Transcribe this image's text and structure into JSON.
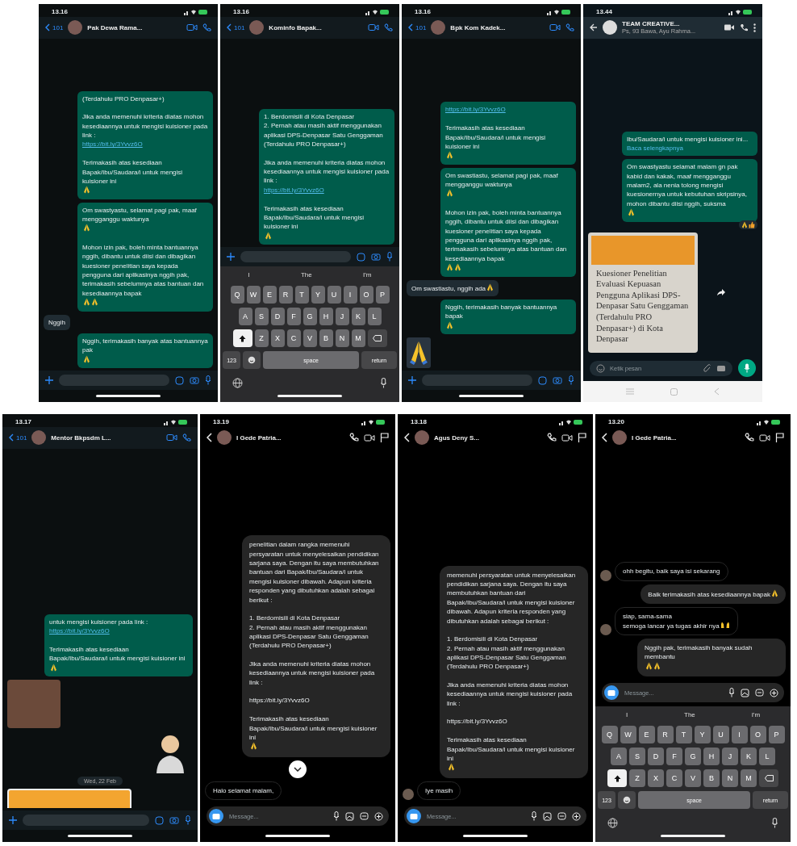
{
  "screens": [
    {
      "kind": "wa_ios",
      "time": "13.16",
      "back_count": "101",
      "name": "Pak Dewa Rama...",
      "messages": [
        {
          "kind": "out",
          "parts": [
            {
              "kind": "text",
              "text": "(Terdahulu PRO Denpasar+)\n\nJika anda memenuhi kriteria diatas mohon kesediaannya untuk mengisi kuisioner pada link :"
            },
            {
              "kind": "link",
              "text": "https://bit.ly/3Yvvz6O"
            },
            {
              "kind": "text",
              "text": "\nTerimakasih atas kesediaan Bapak/Ibu/Saudara/i untuk mengisi kuisioner ini"
            },
            {
              "kind": "pray"
            }
          ]
        },
        {
          "kind": "out",
          "parts": [
            {
              "kind": "text",
              "text": "Om swastyastu, selamat pagi pak, maaf mengganggu waktunya"
            },
            {
              "kind": "pray"
            },
            {
              "kind": "text",
              "text": "\nMohon izin pak, boleh minta bantuannya nggih, dibantu untuk diisi dan dibagikan kuesioner penelitian saya kepada pengguna dari aplikasinya nggih pak, terimakasih sebelumnya atas bantuan dan kesediaannya bapak"
            },
            {
              "kind": "pray"
            },
            {
              "kind": "pray"
            }
          ]
        },
        {
          "kind": "in",
          "parts": [
            {
              "kind": "text",
              "text": "Nggih"
            }
          ]
        },
        {
          "kind": "out",
          "parts": [
            {
              "kind": "text",
              "text": "Nggih, terimakasih banyak atas bantuannya pak"
            },
            {
              "kind": "pray"
            }
          ]
        }
      ]
    },
    {
      "kind": "wa_ios",
      "time": "13.16",
      "back_count": "101",
      "name": "Kominfo Bapak...",
      "messages": [
        {
          "kind": "out",
          "parts": [
            {
              "kind": "text",
              "text": "1. Berdomisili di Kota Denpasar\n2. Pernah atau masih aktif menggunakan aplikasi DPS-Denpasar Satu Genggaman (Terdahulu PRO Denpasar+)\n\nJika anda memenuhi kriteria diatas mohon kesediaannya untuk mengisi kuisioner pada link :"
            },
            {
              "kind": "link",
              "text": "https://bit.ly/3Yvvz6O"
            },
            {
              "kind": "text",
              "text": "\nTerimakasih atas kesediaan Bapak/Ibu/Saudara/i untuk mengisi kuisioner ini"
            },
            {
              "kind": "pray"
            }
          ]
        }
      ],
      "keyboard": {
        "suggestions": [
          "I",
          "The",
          "I'm"
        ],
        "rows": [
          [
            "Q",
            "W",
            "E",
            "R",
            "T",
            "Y",
            "U",
            "I",
            "O",
            "P"
          ],
          [
            "A",
            "S",
            "D",
            "F",
            "G",
            "H",
            "J",
            "K",
            "L"
          ],
          [
            "Z",
            "X",
            "C",
            "V",
            "B",
            "N",
            "M"
          ]
        ],
        "shift_on": true,
        "numbers": "123",
        "space": "space",
        "return": "return"
      }
    },
    {
      "kind": "wa_ios",
      "time": "13.16",
      "back_count": "101",
      "name": "Bpk Kom Kadek...",
      "messages": [
        {
          "kind": "out",
          "parts": [
            {
              "kind": "link",
              "text": "https://bit.ly/3Yvvz6O"
            },
            {
              "kind": "text",
              "text": "\nTerimakasih atas kesediaan Bapak/Ibu/Saudara/i untuk mengisi kuisioner ini"
            },
            {
              "kind": "pray"
            }
          ]
        },
        {
          "kind": "out",
          "parts": [
            {
              "kind": "text",
              "text": "Om swastiastu, selamat pagi pak, maaf mengganggu waktunya"
            },
            {
              "kind": "pray"
            },
            {
              "kind": "text",
              "text": "\nMohon izin pak, boleh minta bantuannya nggih, dibantu untuk diisi dan dibagikan kuesioner penelitian saya kepada pengguna dari aplikasinya nggih pak, terimakasih sebelumnya atas bantuan dan kesediaannya bapak"
            },
            {
              "kind": "pray"
            },
            {
              "kind": "pray"
            }
          ]
        },
        {
          "kind": "in",
          "parts": [
            {
              "kind": "text",
              "text": "Om swastiastu, nggih ada"
            },
            {
              "kind": "pray"
            }
          ]
        },
        {
          "kind": "out",
          "parts": [
            {
              "kind": "text",
              "text": "Nggih, terimakasih banyak bantuannya bapak"
            },
            {
              "kind": "pray"
            }
          ]
        },
        {
          "kind": "sticker_pray"
        }
      ]
    },
    {
      "kind": "wa_android",
      "time": "13.44",
      "name": "TEAM CREATIVE...",
      "subtitle": "Ps, 93 Bawa, Ayu Rahma...",
      "placeholder": "Ketik pesan",
      "messages": [
        {
          "kind": "out",
          "parts": [
            {
              "kind": "text",
              "text": "Ibu/Saudara/i untuk mengisi kuisioner ini..."
            },
            {
              "kind": "more",
              "text": "Baca selengkapnya"
            }
          ]
        },
        {
          "kind": "out",
          "parts": [
            {
              "kind": "text",
              "text": "Om swastyastu selamat malam gn pak kabid dan kakak, maaf mengganggu malam2, ala nenia tolong mengisi kuesionernya untuk kebutuhan skripsinya, mohon dibantu diisi nggih, suksma"
            },
            {
              "kind": "pray"
            }
          ],
          "reactions": [
            {
              "kind": "pray"
            },
            {
              "kind": "thumbs"
            }
          ]
        },
        {
          "kind": "shared_card",
          "title": "Kuesioner Penelitian Evaluasi Kepuasan Pengguna Aplikasi DPS-Denpasar Satu Genggaman (Terdahulu PRO Denpasar+) di Kota Denpasar"
        }
      ]
    },
    {
      "kind": "wa_ios",
      "time": "13.17",
      "back_count": "101",
      "name": "Mentor Bkpsdm L...",
      "messages": [
        {
          "kind": "out",
          "parts": [
            {
              "kind": "text",
              "text": "untuk mengisi kuisioner pada link :"
            },
            {
              "kind": "link",
              "text": "https://bit.ly/3Yvvz6O"
            },
            {
              "kind": "text",
              "text": "\nTerimakasih atas kesediaan Bapak/Ibu/Saudara/i untuk mengisi kuisioner ini"
            },
            {
              "kind": "pray"
            }
          ]
        },
        {
          "kind": "sticker_photo"
        },
        {
          "kind": "sticker_avatar"
        },
        {
          "kind": "date",
          "text": "Wed, 22 Feb"
        },
        {
          "kind": "card"
        }
      ]
    },
    {
      "kind": "instagram",
      "time": "13.19",
      "name": "I Gede Patria...",
      "placeholder": "Message...",
      "messages": [
        {
          "kind": "out",
          "parts": [
            {
              "kind": "text",
              "text": "penelitian dalam rangka memenuhi persyaratan untuk menyelesaikan pendidikan sarjana saya. Dengan itu saya membutuhkan bantuan dari Bapak/Ibu/Saudara/i untuk mengisi kuisioner dibawah. Adapun kriteria responden yang dibutuhkan adalah sebagai berikut :\n\n1. Berdomisili di Kota Denpasar\n2. Pernah atau masih aktif menggunakan aplikasi DPS-Denpasar Satu Genggaman (Terdahulu PRO Denpasar+)\n\nJika anda memenuhi kriteria diatas mohon kesediaannya untuk mengisi kuisioner pada link :\n\nhttps://bit.ly/3Yvvz6O\n\nTerimakasih atas kesediaan Bapak/Ibu/Saudara/i untuk mengisi kuisioner ini"
            },
            {
              "kind": "pray"
            }
          ]
        },
        {
          "kind": "scroll_button"
        },
        {
          "kind": "in",
          "parts": [
            {
              "kind": "text",
              "text": "Halo selamat malam,"
            }
          ]
        }
      ]
    },
    {
      "kind": "instagram",
      "time": "13.18",
      "name": "Agus Deny S...",
      "placeholder": "Message...",
      "messages": [
        {
          "kind": "out",
          "parts": [
            {
              "kind": "text",
              "text": "memenuhi persyaratan untuk menyelesaikan pendidikan sarjana saya. Dengan itu saya membutuhkan bantuan dari Bapak/Ibu/Saudara/i untuk mengisi kuisioner dibawah. Adapun kriteria responden yang dibutuhkan adalah sebagai berikut :\n\n1. Berdomisili di Kota Denpasar\n2. Pernah atau masih aktif menggunakan aplikasi DPS-Denpasar Satu Genggaman (Terdahulu PRO Denpasar+)\n\nJika anda memenuhi kriteria diatas mohon kesediaannya untuk mengisi kuisioner pada link :\n\nhttps://bit.ly/3Yvvz6O\n\nTerimakasih atas kesediaan Bapak/Ibu/Saudara/i untuk mengisi kuisioner ini"
            },
            {
              "kind": "pray"
            }
          ]
        },
        {
          "kind": "in",
          "with_avatar": true,
          "parts": [
            {
              "kind": "text",
              "text": "Iye masih"
            }
          ]
        }
      ]
    },
    {
      "kind": "instagram",
      "time": "13.20",
      "name": "I Gede Patria...",
      "placeholder": "Message...",
      "messages": [
        {
          "kind": "in",
          "with_avatar": true,
          "parts": [
            {
              "kind": "text",
              "text": "ohh begitu, baik saya isi sekarang"
            }
          ]
        },
        {
          "kind": "out",
          "parts": [
            {
              "kind": "text",
              "text": "Baik terimakasih atas kesediaannya bapak"
            },
            {
              "kind": "pray"
            }
          ]
        },
        {
          "kind": "in",
          "with_avatar": true,
          "parts": [
            {
              "kind": "text",
              "text": "siap, sama-sama\nsemoga lancar ya tugas akhir nya\n"
            },
            {
              "kind": "raise"
            }
          ]
        },
        {
          "kind": "out",
          "parts": [
            {
              "kind": "text",
              "text": "Nggih pak, terimakasih banyak sudah membantu"
            },
            {
              "kind": "pray"
            },
            {
              "kind": "pray"
            }
          ]
        }
      ],
      "keyboard": {
        "suggestions": [
          "I",
          "The",
          "I'm"
        ],
        "rows": [
          [
            "Q",
            "W",
            "E",
            "R",
            "T",
            "Y",
            "U",
            "I",
            "O",
            "P"
          ],
          [
            "A",
            "S",
            "D",
            "F",
            "G",
            "H",
            "J",
            "K",
            "L"
          ],
          [
            "Z",
            "X",
            "C",
            "V",
            "B",
            "N",
            "M"
          ]
        ],
        "shift_on": true,
        "numbers": "123",
        "space": "space",
        "return": "return"
      }
    }
  ]
}
